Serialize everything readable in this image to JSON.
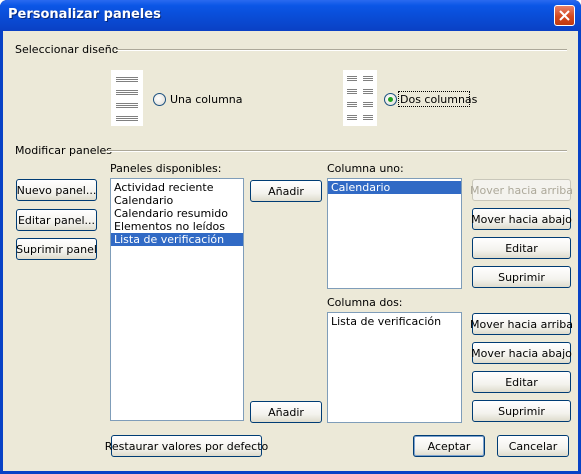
{
  "window": {
    "title": "Personalizar paneles"
  },
  "layout_section": {
    "label": "Seleccionar diseño",
    "options": [
      {
        "label": "Una columna",
        "selected": false,
        "icon": "one-column-layout-icon"
      },
      {
        "label": "Dos columnas",
        "selected": true,
        "icon": "two-column-layout-icon"
      }
    ]
  },
  "modify_section": {
    "label": "Modificar paneles",
    "buttons": {
      "new": "Nuevo panel...",
      "edit": "Editar panel...",
      "delete": "Suprimir panel"
    }
  },
  "available": {
    "label": "Paneles disponibles:",
    "items": [
      "Actividad reciente",
      "Calendario",
      "Calendario resumido",
      "Elementos no leídos",
      "Lista de verificación"
    ],
    "selected_index": 4
  },
  "add_buttons": {
    "add1": "Añadir",
    "add2": "Añadir"
  },
  "column_one": {
    "label": "Columna uno:",
    "items": [
      "Calendario"
    ],
    "selected_index": 0,
    "buttons": {
      "up": "Mover hacia arriba",
      "down": "Mover hacia abajo",
      "edit": "Editar",
      "delete": "Suprimir"
    },
    "up_disabled": true
  },
  "column_two": {
    "label": "Columna dos:",
    "items": [
      "Lista de verificación"
    ],
    "buttons": {
      "up": "Mover hacia arriba",
      "down": "Mover hacia abajo",
      "edit": "Editar",
      "delete": "Suprimir"
    }
  },
  "footer": {
    "restore": "Restaurar valores por defecto",
    "ok": "Aceptar",
    "cancel": "Cancelar"
  },
  "colors": {
    "titlebar": "#0a4bd4",
    "dialog_bg": "#ece9d8",
    "selection": "#316ac5",
    "radio_dot": "#21a121"
  }
}
